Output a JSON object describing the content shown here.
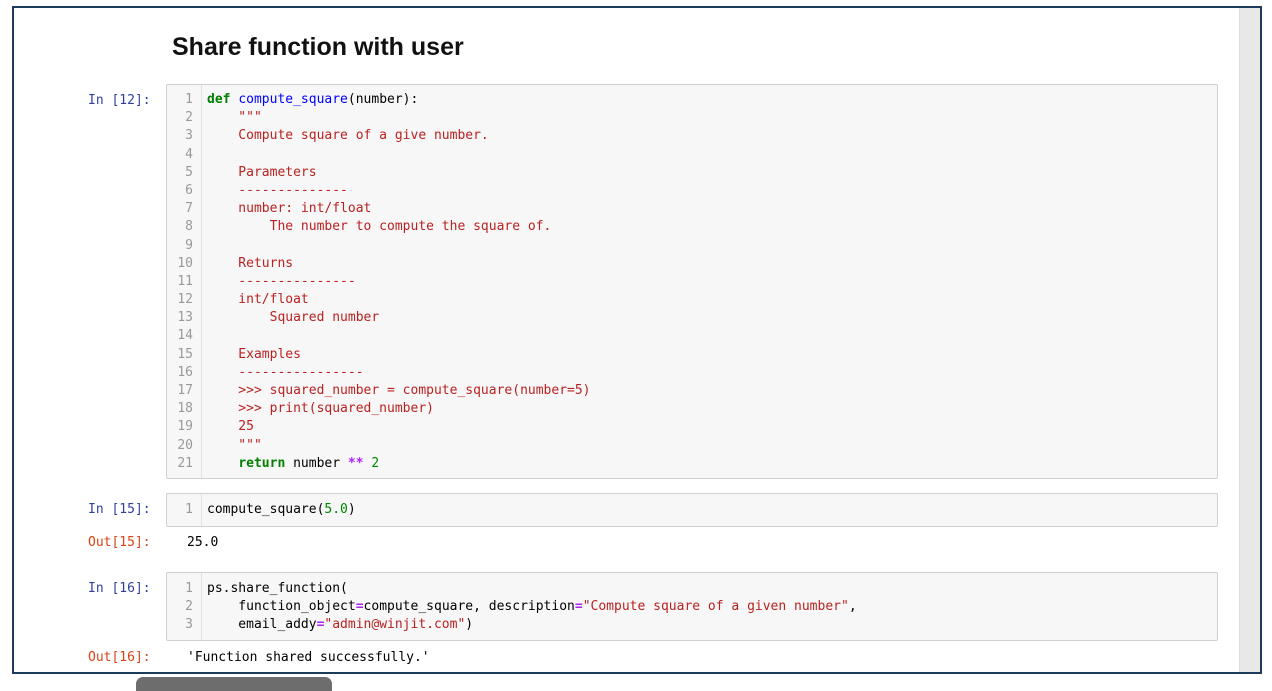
{
  "heading": "Share function with user",
  "cells": [
    {
      "prompt": "In [12]:",
      "lines": [
        {
          "n": "1",
          "tokens": [
            {
              "t": "def",
              "c": "kw"
            },
            {
              "t": " ",
              "c": ""
            },
            {
              "t": "compute_square",
              "c": "fn"
            },
            {
              "t": "(number):",
              "c": ""
            }
          ]
        },
        {
          "n": "2",
          "tokens": [
            {
              "t": "    \"\"\"",
              "c": "str"
            }
          ]
        },
        {
          "n": "3",
          "tokens": [
            {
              "t": "    Compute square of a give number.",
              "c": "str"
            }
          ]
        },
        {
          "n": "4",
          "tokens": []
        },
        {
          "n": "5",
          "tokens": [
            {
              "t": "    Parameters",
              "c": "str"
            }
          ]
        },
        {
          "n": "6",
          "tokens": [
            {
              "t": "    --------------",
              "c": "str"
            }
          ]
        },
        {
          "n": "7",
          "tokens": [
            {
              "t": "    number: int/float",
              "c": "str"
            }
          ]
        },
        {
          "n": "8",
          "tokens": [
            {
              "t": "        The number to compute the square of.",
              "c": "str"
            }
          ]
        },
        {
          "n": "9",
          "tokens": []
        },
        {
          "n": "10",
          "tokens": [
            {
              "t": "    Returns",
              "c": "str"
            }
          ]
        },
        {
          "n": "11",
          "tokens": [
            {
              "t": "    ---------------",
              "c": "str"
            }
          ]
        },
        {
          "n": "12",
          "tokens": [
            {
              "t": "    int/float",
              "c": "str"
            }
          ]
        },
        {
          "n": "13",
          "tokens": [
            {
              "t": "        Squared number",
              "c": "str"
            }
          ]
        },
        {
          "n": "14",
          "tokens": []
        },
        {
          "n": "15",
          "tokens": [
            {
              "t": "    Examples",
              "c": "str"
            }
          ]
        },
        {
          "n": "16",
          "tokens": [
            {
              "t": "    ----------------",
              "c": "str"
            }
          ]
        },
        {
          "n": "17",
          "tokens": [
            {
              "t": "    >>> squared_number = compute_square(number=5)",
              "c": "str"
            }
          ]
        },
        {
          "n": "18",
          "tokens": [
            {
              "t": "    >>> print(squared_number)",
              "c": "str"
            }
          ]
        },
        {
          "n": "19",
          "tokens": [
            {
              "t": "    25",
              "c": "str"
            }
          ]
        },
        {
          "n": "20",
          "tokens": [
            {
              "t": "    \"\"\"",
              "c": "str"
            }
          ]
        },
        {
          "n": "21",
          "tokens": [
            {
              "t": "    ",
              "c": ""
            },
            {
              "t": "return",
              "c": "kw"
            },
            {
              "t": " number ",
              "c": ""
            },
            {
              "t": "**",
              "c": "op"
            },
            {
              "t": " ",
              "c": ""
            },
            {
              "t": "2",
              "c": "num"
            }
          ]
        }
      ]
    },
    {
      "prompt": "In [15]:",
      "lines": [
        {
          "n": "1",
          "tokens": [
            {
              "t": "compute_square(",
              "c": ""
            },
            {
              "t": "5.0",
              "c": "num"
            },
            {
              "t": ")",
              "c": ""
            }
          ]
        }
      ],
      "out_prompt": "Out[15]:",
      "output": "25.0"
    },
    {
      "prompt": "In [16]:",
      "lines": [
        {
          "n": "1",
          "tokens": [
            {
              "t": "ps.share_function(",
              "c": ""
            }
          ]
        },
        {
          "n": "2",
          "tokens": [
            {
              "t": "    function_object",
              "c": ""
            },
            {
              "t": "=",
              "c": "op"
            },
            {
              "t": "compute_square, description",
              "c": ""
            },
            {
              "t": "=",
              "c": "op"
            },
            {
              "t": "\"Compute square of a given number\"",
              "c": "str"
            },
            {
              "t": ",",
              "c": ""
            }
          ]
        },
        {
          "n": "3",
          "tokens": [
            {
              "t": "    email_addy",
              "c": ""
            },
            {
              "t": "=",
              "c": "op"
            },
            {
              "t": "\"admin@winjit.com\"",
              "c": "str"
            },
            {
              "t": ")",
              "c": ""
            }
          ]
        }
      ],
      "out_prompt": "Out[16]:",
      "output": "'Function shared successfully.'"
    }
  ]
}
